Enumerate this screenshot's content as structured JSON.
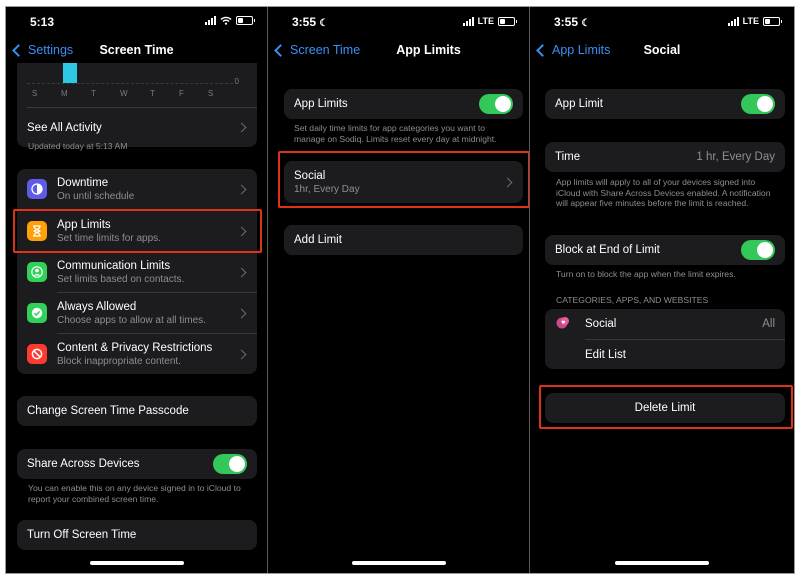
{
  "panel1": {
    "time": "5:13",
    "back": "Settings",
    "title": "Screen Time",
    "chart": {
      "day_labels": [
        "S",
        "M",
        "T",
        "W",
        "T",
        "F",
        "S"
      ],
      "zero_label": "0"
    },
    "see_all": "See All Activity",
    "updated": "Updated today at 5:13 AM",
    "items": [
      {
        "label": "Downtime",
        "sub": "On until schedule",
        "color": "#5e5ce6"
      },
      {
        "label": "App Limits",
        "sub": "Set time limits for apps.",
        "color": "#ff9f0a"
      },
      {
        "label": "Communication Limits",
        "sub": "Set limits based on contacts.",
        "color": "#30d158"
      },
      {
        "label": "Always Allowed",
        "sub": "Choose apps to allow at all times.",
        "color": "#30d158"
      },
      {
        "label": "Content & Privacy Restrictions",
        "sub": "Block inappropriate content.",
        "color": "#ff3b30"
      }
    ],
    "change_passcode": "Change Screen Time Passcode",
    "share_label": "Share Across Devices",
    "share_note": "You can enable this on any device signed in to iCloud to report your combined screen time.",
    "turn_off": "Turn Off Screen Time"
  },
  "panel2": {
    "time": "3:55",
    "network": "LTE",
    "back": "Screen Time",
    "title": "App Limits",
    "toggle_label": "App Limits",
    "note": "Set daily time limits for app categories you want to manage on Sodiq. Limits reset every day at midnight.",
    "limit_name": "Social",
    "limit_sub": "1hr, Every Day",
    "add_limit": "Add Limit"
  },
  "panel3": {
    "time": "3:55",
    "network": "LTE",
    "back": "App Limits",
    "title": "Social",
    "app_limit_label": "App Limit",
    "time_label": "Time",
    "time_value": "1 hr, Every Day",
    "time_note": "App limits will apply to all of your devices signed into iCloud with Share Across Devices enabled. A notification will appear five minutes before the limit is reached.",
    "block_label": "Block at End of Limit",
    "block_note": "Turn on to block the app when the limit expires.",
    "section_header": "CATEGORIES, APPS, AND WEBSITES",
    "category": "Social",
    "category_value": "All",
    "edit_list": "Edit List",
    "delete_limit": "Delete Limit"
  }
}
